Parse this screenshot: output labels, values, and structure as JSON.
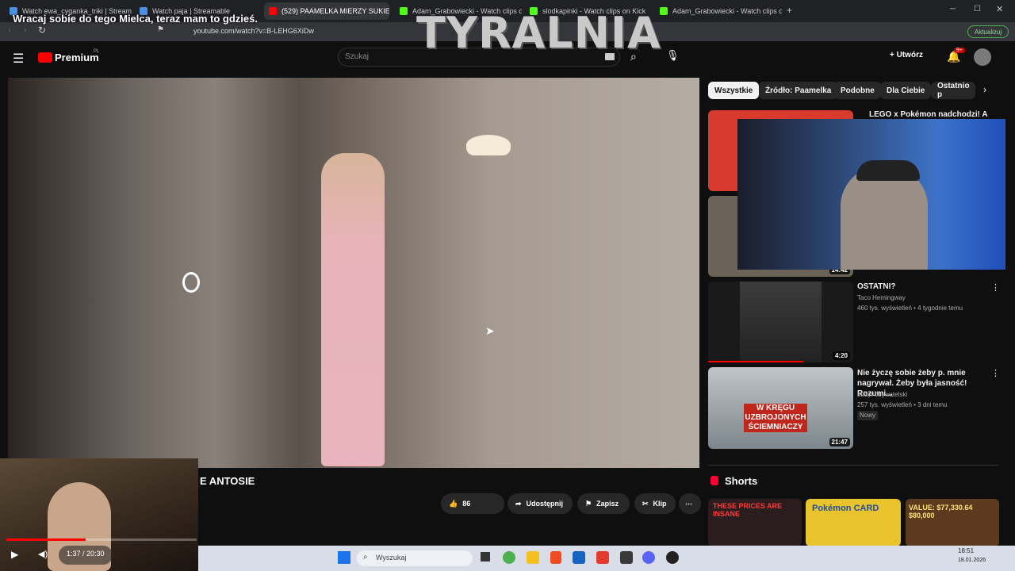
{
  "tabs": [
    {
      "label": "Watch ewa_cyganka_triki | Streamable"
    },
    {
      "label": "Watch paja | Streamable"
    },
    {
      "label": "(529) PAAMELKA MIERZY SUKIE"
    },
    {
      "label": "Adam_Grabowiecki - Watch clips on"
    },
    {
      "label": "slodkapinki - Watch clips on Kick"
    },
    {
      "label": "Adam_Grabowiecki - Watch clips on"
    }
  ],
  "overlay_caption": "Wracaj sobie do tego Mielca, teraz mam to gdzieś.",
  "watermark": "TYRALNIA",
  "url": "youtube.com/watch?v=B-LEHG6XiDw",
  "update_button": "Aktualizuj",
  "yt": {
    "logo": "Premium",
    "logo_region": "PL",
    "search_placeholder": "Szukaj",
    "create_button": "Utwórz",
    "notif_count": "9+"
  },
  "filters": [
    "Wszystkie",
    "Źródło: Paamelka",
    "Podobne",
    "Dla Ciebie",
    "Ostatnio p"
  ],
  "video": {
    "title_fragment": "E ANTOSIE",
    "likes": "86",
    "share": "Udostępnij",
    "save": "Zapisz",
    "clip": "Klip",
    "time": "1:37 / 20:30"
  },
  "related": [
    {
      "title": "LEGO x Pokémon nadchodzi! Ale",
      "thumb_text": "Mamy problem",
      "duration": ""
    },
    {
      "title": "",
      "duration": "14:42"
    },
    {
      "title": "OSTATNI?",
      "channel": "Taco Hemingway",
      "meta": "460 tys. wyświetleń • 4 tygodnie temu",
      "duration": "4:20"
    },
    {
      "title": "Nie życzę sobie żeby p. mnie nagrywał. Żeby była jasność! Rozumi...",
      "channel": "audyt obywatelski",
      "meta": "257 tys. wyświetleń • 3 dni temu",
      "badge": "Nowy",
      "duration": "21:47",
      "thumb_text": "W KRĘGU UZBROJONYCH ŚCIEMNIACZY"
    }
  ],
  "shorts": {
    "heading": "Shorts",
    "items": [
      "THESE PRICES ARE INSANE",
      "Pokémon CARD",
      "VALUE: $77,330.64 $80,000"
    ]
  },
  "taskbar": {
    "search": "Wyszukaj",
    "time": "18:51",
    "date": "18.01.2026"
  },
  "colors": {
    "yt_red": "#ff0000",
    "accent_blue": "#3ea6ff",
    "bg": "#0f0f0f"
  }
}
